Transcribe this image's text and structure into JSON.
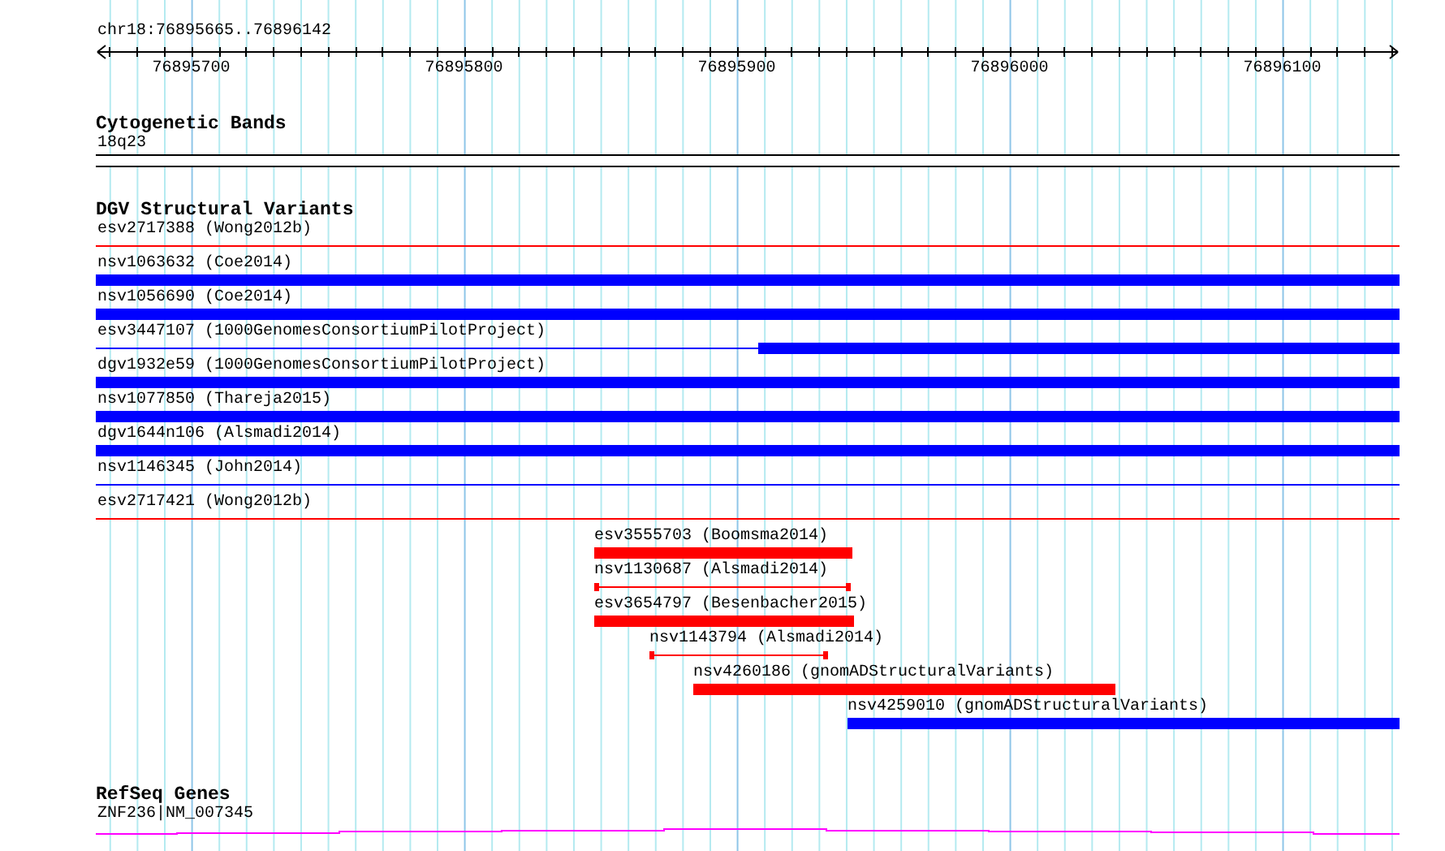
{
  "ruler": {
    "position": "chr18:76895665..76896142",
    "ticks": [
      "76895700",
      "76895800",
      "76895900",
      "76896000",
      "76896100"
    ]
  },
  "cytogenetic_bands": {
    "title": "Cytogenetic Bands",
    "band": "18q23"
  },
  "dgv_structural_variants": {
    "title": "DGV Structural Variants",
    "variants": [
      {
        "label": "esv2717388 (Wong2012b)",
        "kind": "thin",
        "color": "#ff0000"
      },
      {
        "label": "nsv1063632 (Coe2014)",
        "kind": "thick",
        "color": "#0000ff"
      },
      {
        "label": "nsv1056690 (Coe2014)",
        "kind": "thick",
        "color": "#0000ff"
      },
      {
        "label": "esv3447107 (1000GenomesConsortiumPilotProject)",
        "kind": "mixed",
        "color": "#0000ff"
      },
      {
        "label": "dgv1932e59 (1000GenomesConsortiumPilotProject)",
        "kind": "thick",
        "color": "#0000ff"
      },
      {
        "label": "nsv1077850 (Thareja2015)",
        "kind": "thick",
        "color": "#0000ff"
      },
      {
        "label": "dgv1644n106 (Alsmadi2014)",
        "kind": "thick",
        "color": "#0000ff"
      },
      {
        "label": "nsv1146345 (John2014)",
        "kind": "thin",
        "color": "#0000ff"
      },
      {
        "label": "esv2717421 (Wong2012b)",
        "kind": "thin",
        "color": "#ff0000"
      },
      {
        "label": "esv3555703 (Boomsma2014)",
        "kind": "thick",
        "color": "#ff0000"
      },
      {
        "label": "nsv1130687 (Alsmadi2014)",
        "kind": "capped",
        "color": "#ff0000"
      },
      {
        "label": "esv3654797 (Besenbacher2015)",
        "kind": "thick",
        "color": "#ff0000"
      },
      {
        "label": "nsv1143794 (Alsmadi2014)",
        "kind": "capped",
        "color": "#ff0000"
      },
      {
        "label": "nsv4260186 (gnomADStructuralVariants)",
        "kind": "thick",
        "color": "#ff0000"
      },
      {
        "label": "nsv4259010 (gnomADStructuralVariants)",
        "kind": "thick",
        "color": "#0000ff"
      }
    ]
  },
  "refseq_genes": {
    "title": "RefSeq Genes",
    "gene": "ZNF236|NM_007345"
  }
}
